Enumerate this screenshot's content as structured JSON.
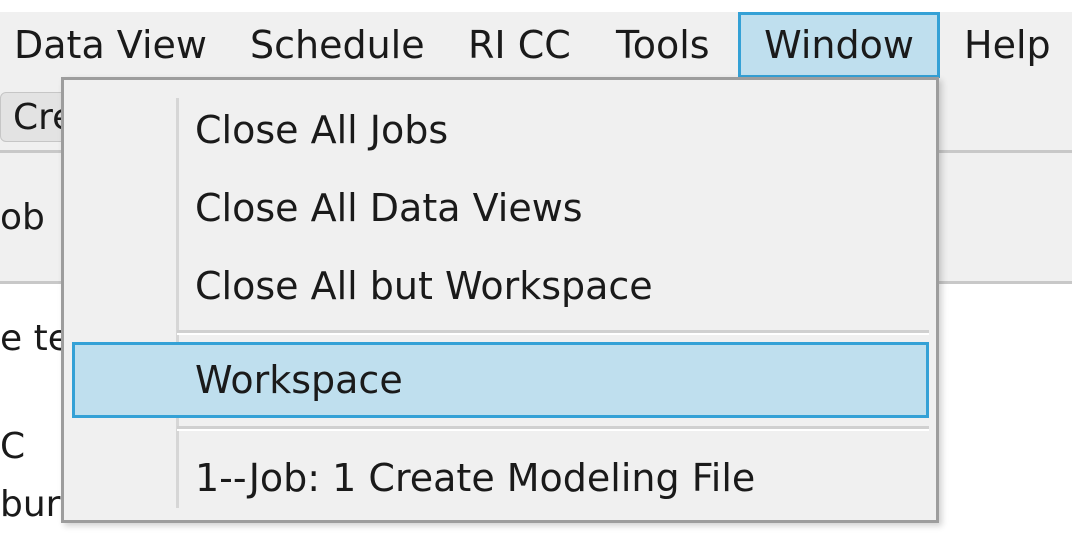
{
  "menubar": {
    "items": [
      {
        "label": "Data View"
      },
      {
        "label": "Schedule"
      },
      {
        "label": "RI CC"
      },
      {
        "label": "Tools"
      },
      {
        "label": "Window",
        "active": true
      },
      {
        "label": "Help"
      }
    ]
  },
  "toolbar": {
    "tab_stub": "Cre"
  },
  "tabstrip": {
    "tab_label": "ob"
  },
  "content": {
    "line1": "e te",
    "line2": "C",
    "line3": "bur"
  },
  "window_menu": {
    "items": [
      {
        "label": "Close All Jobs"
      },
      {
        "label": "Close All Data Views"
      },
      {
        "label": "Close All but Workspace"
      },
      {
        "label": "Workspace",
        "highlighted": true
      },
      {
        "label": "1--Job: 1 Create Modeling File"
      }
    ]
  },
  "colors": {
    "menubar_bg": "#f0f0f0",
    "highlight_bg": "#bfdfee",
    "highlight_border": "#34a1d6"
  }
}
